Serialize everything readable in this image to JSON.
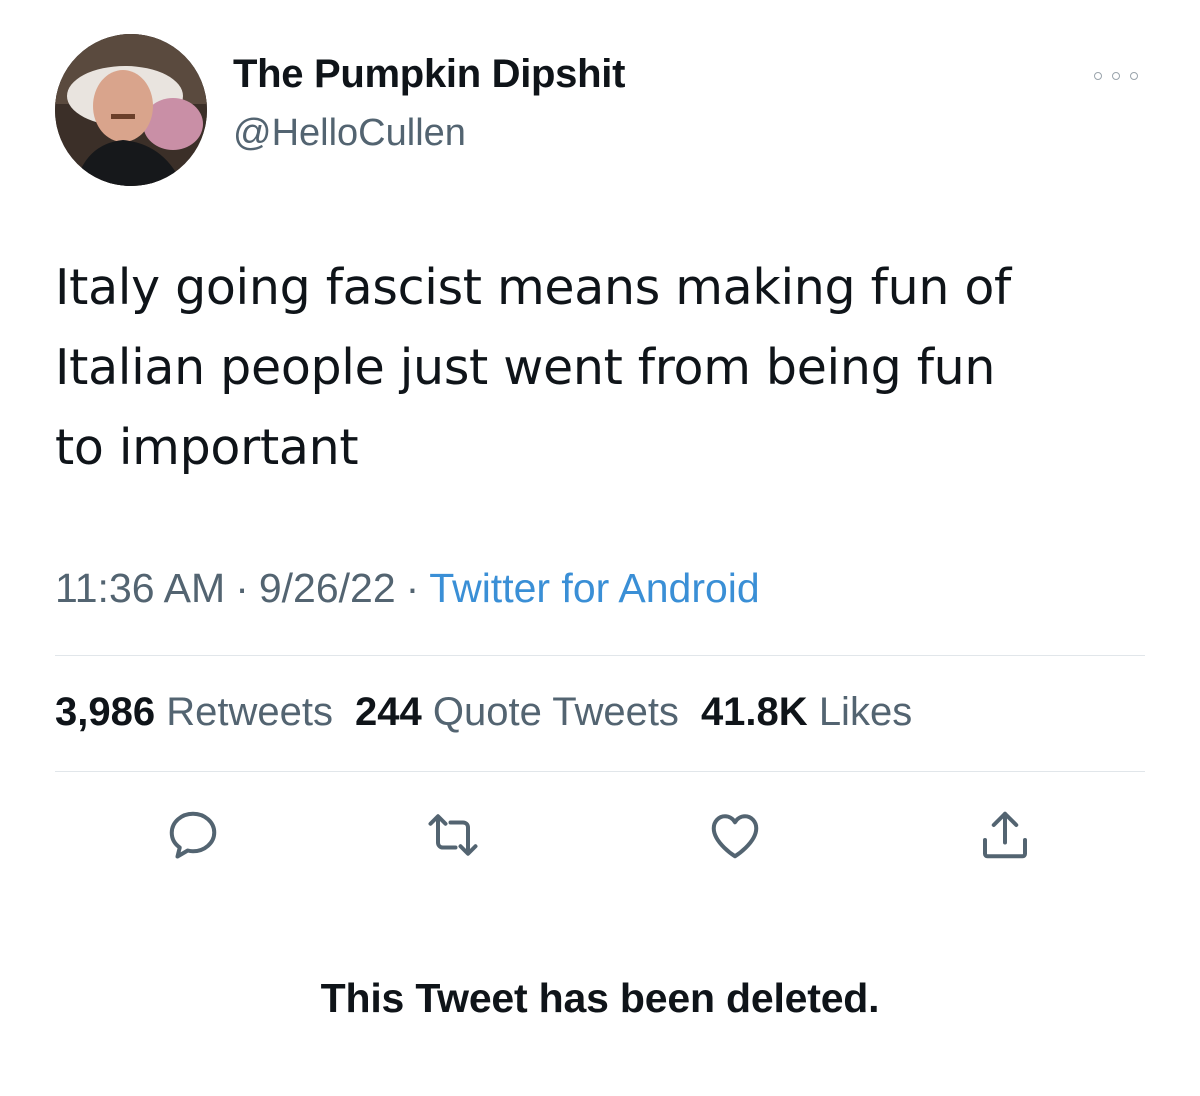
{
  "author": {
    "display_name": "The Pumpkin Dipshit",
    "handle": "@HelloCullen",
    "avatar_icon": "profile-photo"
  },
  "header": {
    "more_icon": "more-horizontal-icon"
  },
  "tweet": {
    "text_lines": [
      "Italy going fascist means making fun of",
      "Italian people just went from being fun",
      "to important"
    ],
    "time": "11:36 AM",
    "date": "9/26/22",
    "source": "Twitter for Android",
    "separator": "·"
  },
  "stats": {
    "retweets_count": "3,986",
    "retweets_label": "Retweets",
    "quotes_count": "244",
    "quotes_label": "Quote Tweets",
    "likes_count": "41.8K",
    "likes_label": "Likes"
  },
  "actions": [
    {
      "name": "reply",
      "icon": "reply-icon"
    },
    {
      "name": "retweet",
      "icon": "retweet-icon"
    },
    {
      "name": "like",
      "icon": "heart-icon"
    },
    {
      "name": "share",
      "icon": "share-icon"
    }
  ],
  "notice": {
    "text": "This Tweet has been deleted."
  },
  "colors": {
    "text": "#0f1419",
    "secondary": "#536471",
    "link": "#3a8fd6",
    "divider": "#e1e6ea"
  }
}
